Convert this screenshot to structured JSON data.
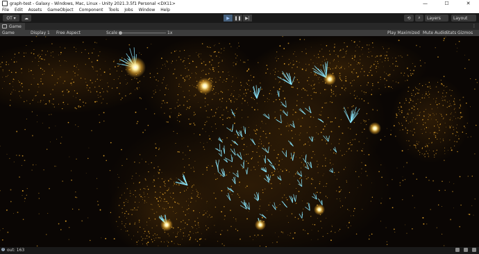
{
  "window": {
    "title": "graph-test - Galaxy - Windows, Mac, Linux - Unity 2021.3.5f1 Personal <DX11>",
    "minimize": "—",
    "maximize": "☐",
    "close": "✕"
  },
  "menu": {
    "items": [
      "File",
      "Edit",
      "Assets",
      "GameObject",
      "Component",
      "Tools",
      "Jobs",
      "Window",
      "Help"
    ]
  },
  "toolbar": {
    "account_label": "OT ▾",
    "layers_label": "Layers",
    "layout_label": "Layout",
    "play_icon": "▶",
    "pause_icon": "❚❚",
    "step_icon": "▶|"
  },
  "tab": {
    "label": "Game",
    "menu": "⋮"
  },
  "game_controls": {
    "view": "Game",
    "display": "Display 1",
    "aspect": "Free Aspect",
    "scale_label": "Scale",
    "scale_value": "1x",
    "play_mode": "Play Maximized",
    "mute": "Mute Audio",
    "stats": "Stats",
    "gizmos": "Gizmos"
  },
  "status": {
    "message": "out: 163"
  },
  "colors": {
    "gold": "#ffb830",
    "cyan": "#8ae8ff"
  }
}
